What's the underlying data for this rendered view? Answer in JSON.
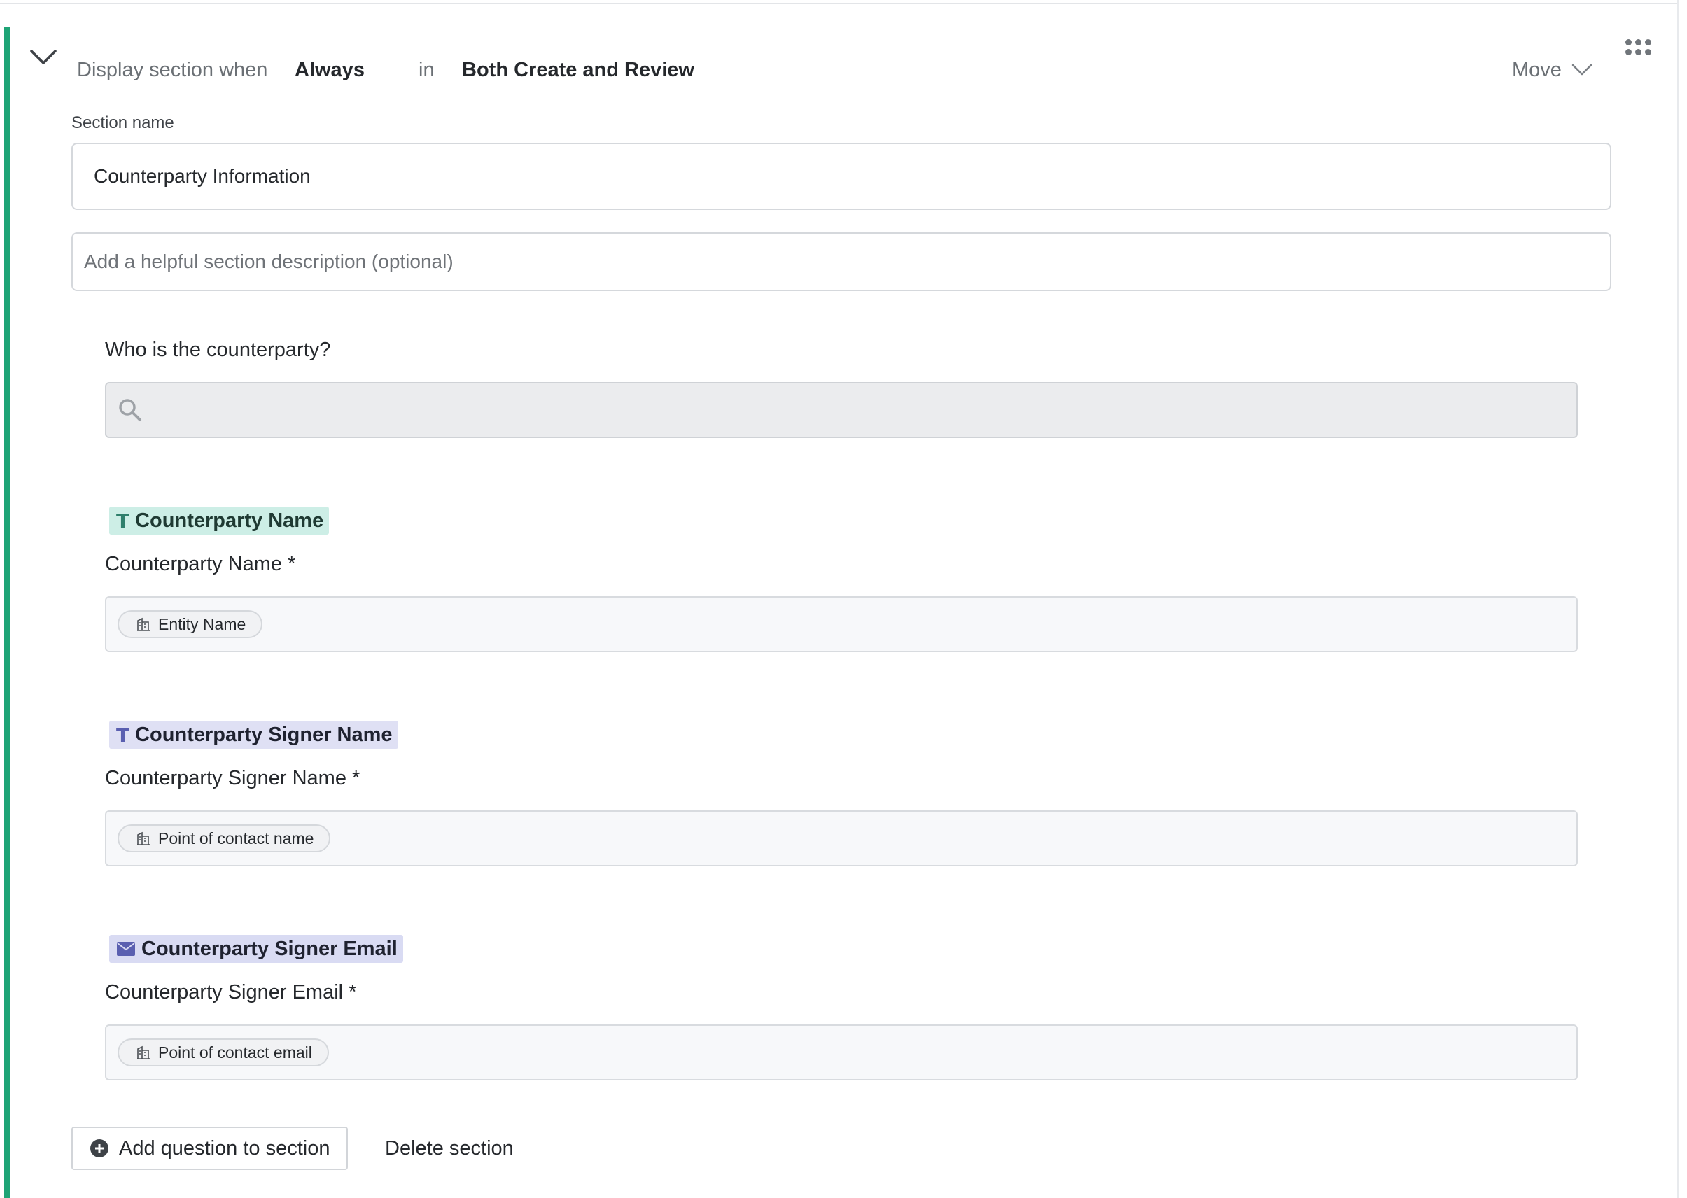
{
  "section": {
    "display_when_label": "Display section when",
    "display_when_value": "Always",
    "in_label": "in",
    "scope_value": "Both Create and Review",
    "move_label": "Move",
    "name_label": "Section name",
    "name_value": "Counterparty Information",
    "description_placeholder": "Add a helpful section description (optional)",
    "accent_color": "#1ea476"
  },
  "lookup": {
    "question": "Who is the counterparty?",
    "icon": "search-icon"
  },
  "questions": [
    {
      "tag_label": "Counterparty Name",
      "tag_icon": "text-type-icon",
      "tag_color": "#cdeee6",
      "label": "Counterparty Name *",
      "mapped_field": "Entity Name",
      "chip_icon": "building-icon"
    },
    {
      "tag_label": "Counterparty Signer Name",
      "tag_icon": "text-type-icon",
      "tag_color": "#dfe0f4",
      "label": "Counterparty Signer Name *",
      "mapped_field": "Point of contact name",
      "chip_icon": "building-icon"
    },
    {
      "tag_label": "Counterparty Signer Email",
      "tag_icon": "envelope-icon",
      "tag_color": "#d9dbf3",
      "label": "Counterparty Signer Email *",
      "mapped_field": "Point of contact email",
      "chip_icon": "building-icon"
    }
  ],
  "actions": {
    "add_question": "Add question to section",
    "delete_section": "Delete section"
  }
}
